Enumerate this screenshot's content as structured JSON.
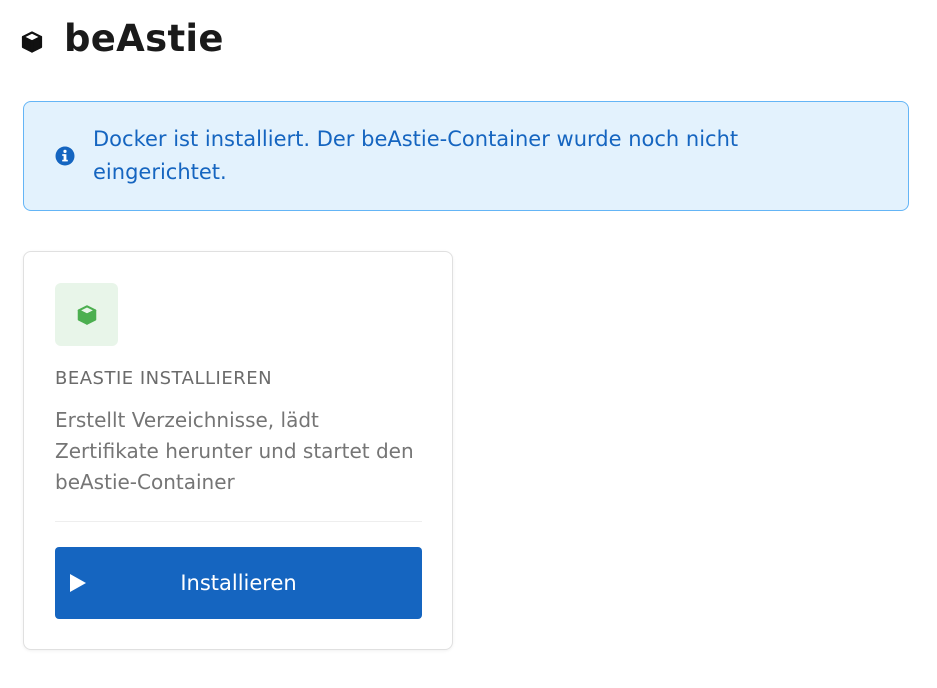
{
  "header": {
    "title": "beAstie",
    "icon": "cube-icon"
  },
  "alert": {
    "icon": "info-circle-icon",
    "message": "Docker ist installiert. Der beAstie-Container wurde noch nicht eingerichtet.",
    "colors": {
      "background": "#e3f2fd",
      "border": "#64b5f6",
      "text": "#1565c0"
    }
  },
  "install_card": {
    "icon": "cube-icon",
    "title": "BEASTIE INSTALLIEREN",
    "description": "Erstellt Verzeichnisse, lädt Zertifikate herunter und startet den beAstie-Container",
    "button": {
      "label": "Installieren",
      "icon": "play-icon",
      "color": "#1565c0"
    },
    "accent_color": "#4caf50"
  }
}
